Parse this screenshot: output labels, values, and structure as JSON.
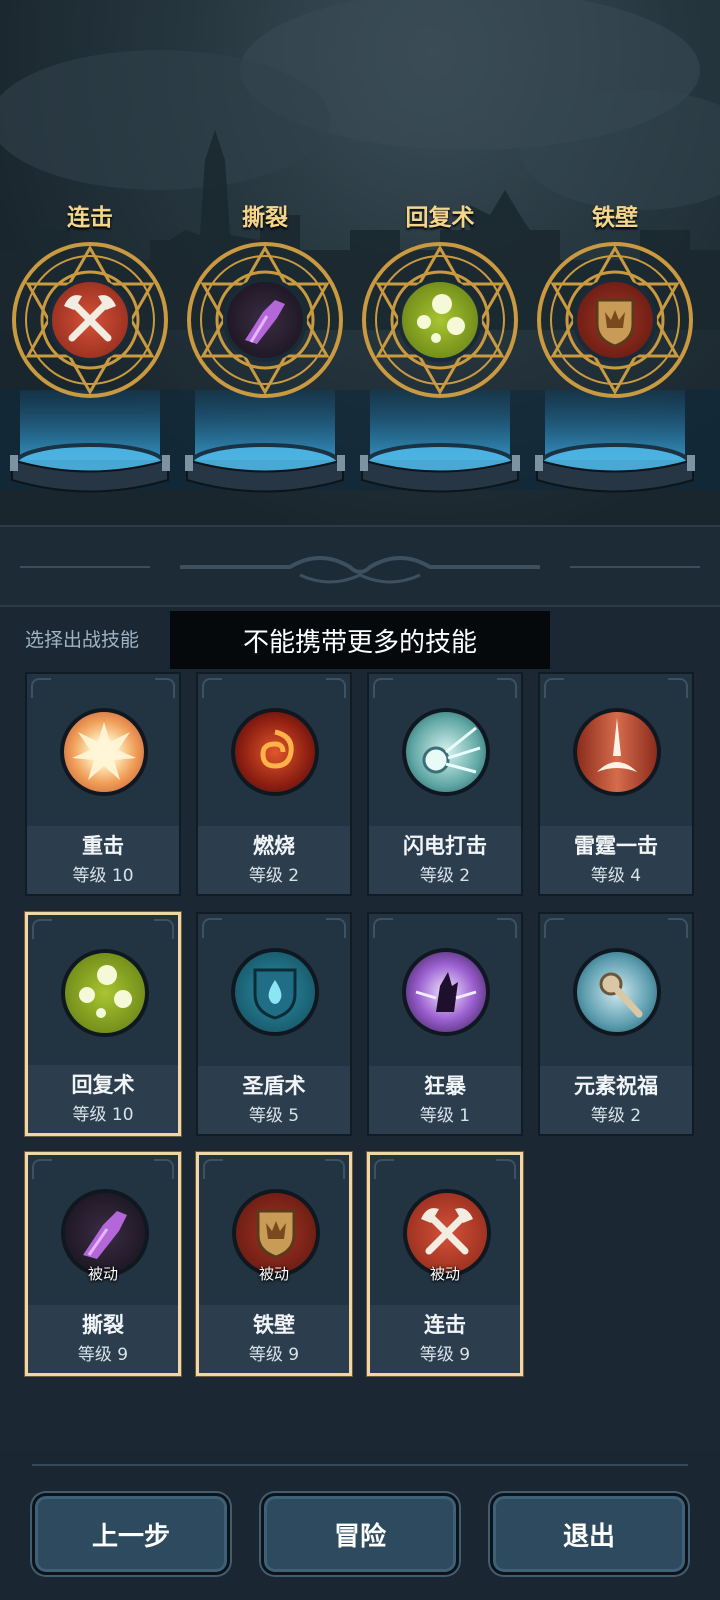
{
  "equipped": [
    {
      "name": "连击",
      "icon": "crossed-axes-icon"
    },
    {
      "name": "撕裂",
      "icon": "purple-claw-icon"
    },
    {
      "name": "回复术",
      "icon": "green-orbs-icon"
    },
    {
      "name": "铁壁",
      "icon": "shield-crown-icon"
    }
  ],
  "select_label": "选择出战技能",
  "toast": "不能携带更多的技能",
  "skills": [
    {
      "name": "重击",
      "level": "等级 10",
      "icon": "impact-burst-icon",
      "selected": false
    },
    {
      "name": "燃烧",
      "level": "等级 2",
      "icon": "fire-swirl-icon",
      "selected": false
    },
    {
      "name": "闪电打击",
      "level": "等级 2",
      "icon": "lightning-orb-icon",
      "selected": false
    },
    {
      "name": "雷霆一击",
      "level": "等级 4",
      "icon": "thunder-strike-icon",
      "selected": false
    },
    {
      "name": "回复术",
      "level": "等级 10",
      "icon": "green-orbs-icon",
      "selected": true
    },
    {
      "name": "圣盾术",
      "level": "等级 5",
      "icon": "water-shield-icon",
      "selected": false
    },
    {
      "name": "狂暴",
      "level": "等级 1",
      "icon": "purple-rage-icon",
      "selected": false
    },
    {
      "name": "元素祝福",
      "level": "等级 2",
      "icon": "staff-blessing-icon",
      "selected": false
    },
    {
      "name": "撕裂",
      "level": "等级 9",
      "icon": "purple-claw-icon",
      "selected": true,
      "tag": "被动"
    },
    {
      "name": "铁壁",
      "level": "等级 9",
      "icon": "shield-crown-icon",
      "selected": true,
      "tag": "被动"
    },
    {
      "name": "连击",
      "level": "等级 9",
      "icon": "crossed-axes-icon",
      "selected": true,
      "tag": "被动"
    }
  ],
  "buttons": {
    "back": "上一步",
    "adventure": "冒险",
    "exit": "退出"
  }
}
